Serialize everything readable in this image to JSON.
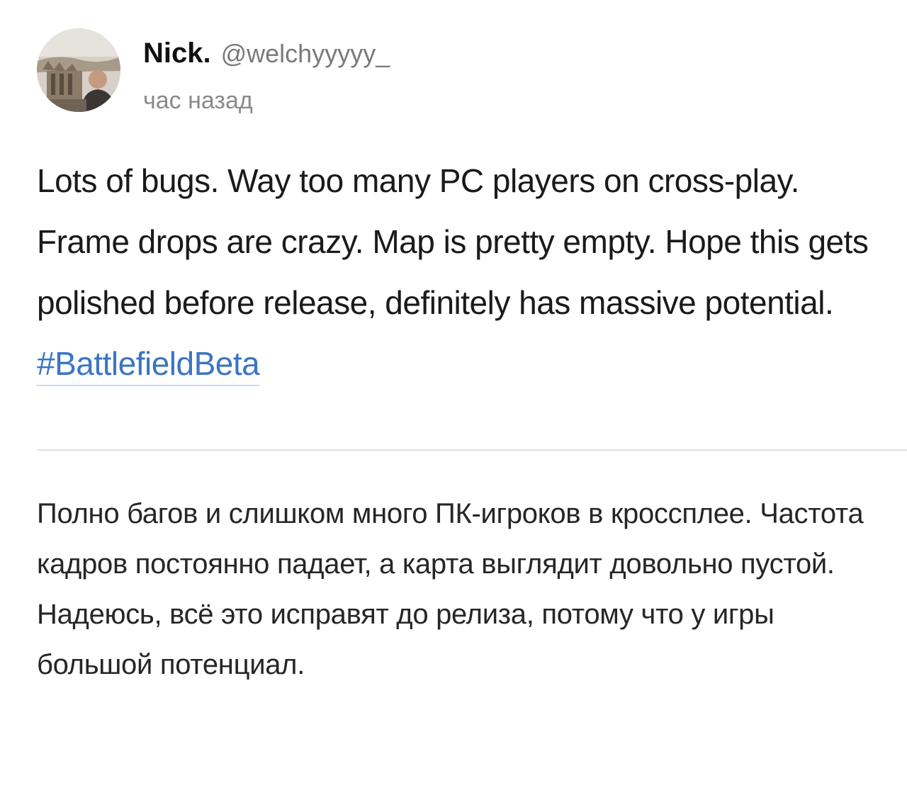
{
  "author": {
    "display_name": "Nick.",
    "handle": "@welchyyyyy_",
    "avatar_icon": "user-avatar-photo"
  },
  "post": {
    "timestamp": "час назад",
    "text": "Lots of bugs. Way too many PC players on cross-play. Frame drops are crazy. Map is pretty empty. Hope this gets polished before release, definitely has massive potential.",
    "hashtag": "#BattlefieldBeta"
  },
  "translation": {
    "text": "Полно багов и слишком много ПК-игроков в кроссплее. Частота кадров постоянно падает, а карта выглядит довольно пустой. Надеюсь, всё это исправят до релиза, потому что у игры большой потенциал."
  },
  "colors": {
    "hashtag": "#3a75c4",
    "divider": "#dedede",
    "secondary_text": "#8a8a8a"
  }
}
